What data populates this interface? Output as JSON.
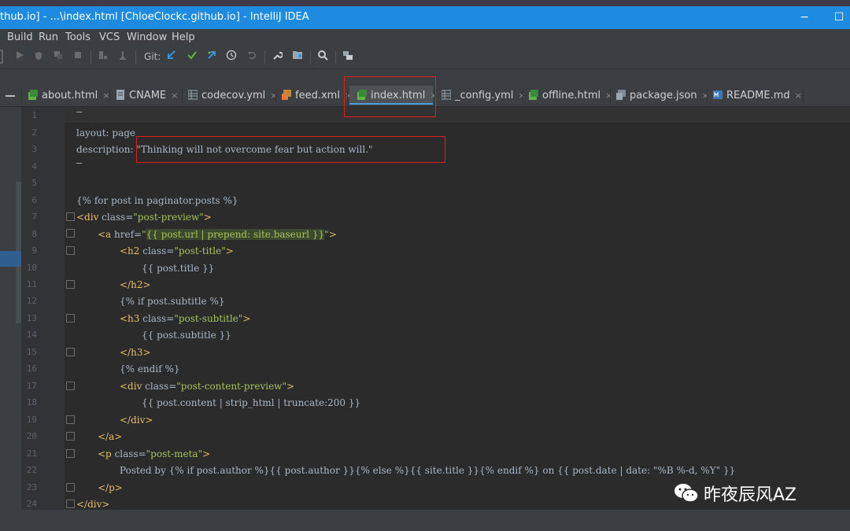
{
  "window": {
    "title": "thub.io] - ...\\index.html [ChloeClockc.github.io] - IntelliJ IDEA",
    "minimize": "−",
    "maximize": "☐"
  },
  "menu": [
    "Build",
    "Run",
    "Tools",
    "VCS",
    "Window",
    "Help"
  ],
  "toolbar": {
    "git_label": "Git:"
  },
  "tabs": [
    {
      "label": "about.html",
      "icon": "html-file-icon",
      "active": false
    },
    {
      "label": "CNAME",
      "icon": "text-file-icon",
      "active": false
    },
    {
      "label": "codecov.yml",
      "icon": "yml-file-icon",
      "active": false
    },
    {
      "label": "feed.xml",
      "icon": "xml-file-icon",
      "active": false
    },
    {
      "label": "index.html",
      "icon": "html-file-icon",
      "active": true
    },
    {
      "label": "_config.yml",
      "icon": "yml-file-icon",
      "active": false
    },
    {
      "label": "offline.html",
      "icon": "html-file-icon",
      "active": false
    },
    {
      "label": "package.json",
      "icon": "json-file-icon",
      "active": false
    },
    {
      "label": "README.md",
      "icon": "md-file-icon",
      "active": false
    }
  ],
  "close_glyph": "×",
  "line_numbers": [
    "1",
    "2",
    "3",
    "4",
    "5",
    "6",
    "7",
    "8",
    "9",
    "10",
    "11",
    "12",
    "13",
    "14",
    "15",
    "16",
    "17",
    "18",
    "19",
    "20",
    "21",
    "22",
    "23",
    "24"
  ],
  "code": {
    "l1": "—",
    "l2": "layout: page",
    "l3a": "description: ",
    "l3b": "\"Thinking will not overcome fear but action will.\"",
    "l4": "—",
    "l6": "{% for post in paginator.posts %}",
    "l7a": "<div ",
    "l7b": "class=",
    "l7c": "\"post-preview\"",
    "l7d": ">",
    "l8a": "<a ",
    "l8b": "href=",
    "l8c": "\"",
    "l8d": "{{ post.url | prepend: site.baseurl }}",
    "l8e": "\"",
    "l8f": ">",
    "l9a": "<h2 ",
    "l9b": "class=",
    "l9c": "\"post-title\"",
    "l9d": ">",
    "l10": "{{ post.title }}",
    "l11": "</h2>",
    "l12": "{% if post.subtitle %}",
    "l13a": "<h3 ",
    "l13b": "class=",
    "l13c": "\"post-subtitle\"",
    "l13d": ">",
    "l14": "{{ post.subtitle }}",
    "l15": "</h3>",
    "l16": "{% endif %}",
    "l17a": "<div ",
    "l17b": "class=",
    "l17c": "\"post-content-preview\"",
    "l17d": ">",
    "l18": "{{ post.content | strip_html | truncate:200 }}",
    "l19": "</div>",
    "l20": "</a>",
    "l21a": "<p ",
    "l21b": "class=",
    "l21c": "\"post-meta\"",
    "l21d": ">",
    "l22": "Posted by {% if post.author %}{{ post.author }}{% else %}{{ site.title }}{% endif %} on {{ post.date | date: \"%B %-d, %Y\" }}",
    "l23": "</p>",
    "l24": "</div>"
  },
  "watermark": "昨夜辰风AZ",
  "colors": {
    "titlebar": "#1e8be0",
    "editor_bg": "#2b2b2b",
    "tag": "#e8bf6a",
    "string": "#a5c25c",
    "highlight_box": "#e02020"
  }
}
